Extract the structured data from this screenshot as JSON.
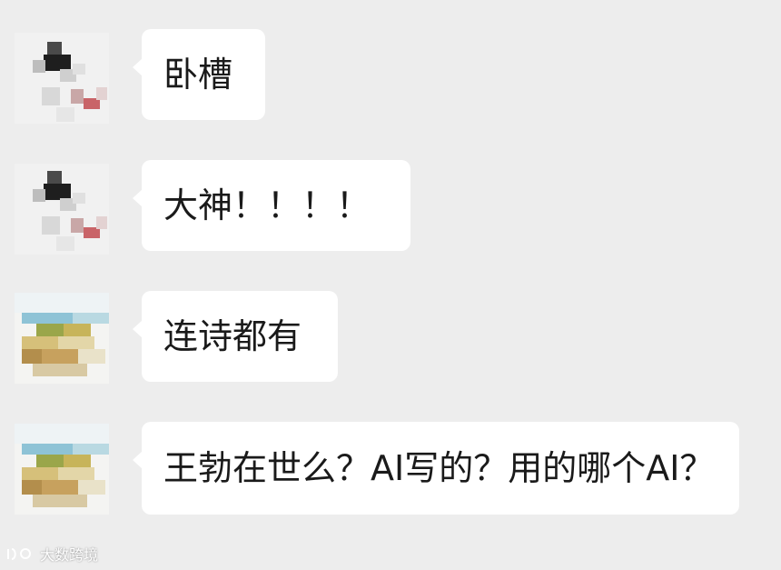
{
  "chat": {
    "messages": [
      {
        "sender": "user_a",
        "text": "卧槽"
      },
      {
        "sender": "user_a",
        "text": "大神！！！！"
      },
      {
        "sender": "user_b",
        "text": "连诗都有"
      },
      {
        "sender": "user_b",
        "text": "王勃在世么？AI写的？用的哪个AI？"
      }
    ]
  },
  "watermark": {
    "text": "大数跨境",
    "icon": "logo-icon"
  },
  "colors": {
    "background": "#ededed",
    "bubble": "#ffffff",
    "text": "#1a1a1a"
  }
}
